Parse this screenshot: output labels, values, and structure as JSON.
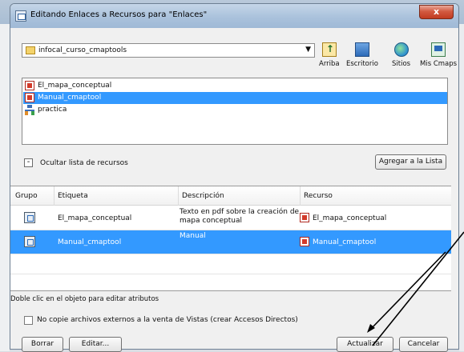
{
  "window": {
    "title": "Editando Enlaces a Recursos para \"Enlaces\"",
    "close_label": "x"
  },
  "folder_combo": {
    "value": "infocal_curso_cmaptools"
  },
  "nav": {
    "arriba": "Arriba",
    "escritorio": "Escritorio",
    "sitios": "Sitios",
    "mis_cmaps": "Mis Cmaps"
  },
  "resources": [
    {
      "label": "El_mapa_conceptual",
      "icon": "pdf-icon",
      "selected": false
    },
    {
      "label": "Manual_cmaptool",
      "icon": "pdf-icon",
      "selected": true
    },
    {
      "label": "practica",
      "icon": "network-icon",
      "selected": false
    }
  ],
  "toggle": {
    "symbol": "-",
    "label": "Ocultar lista de recursos"
  },
  "add_button": "Agregar a la Lista",
  "table": {
    "headers": [
      "Grupo",
      "Etiqueta",
      "Descripción",
      "Recurso"
    ],
    "rows": [
      {
        "label": "El_mapa_conceptual",
        "description": "Texto en pdf sobre la creación de mapa conceptual",
        "desc1": "Texto en pdf sobre la creación de",
        "desc2": "mapa conceptual",
        "resource": "El_mapa_conceptual",
        "selected": false
      },
      {
        "label": "Manual_cmaptool",
        "description": "Manual",
        "desc1": "Manual",
        "desc2": "",
        "resource": "Manual_cmaptool",
        "selected": true
      }
    ]
  },
  "hint": "Doble clic en el objeto para editar atributos",
  "checkbox": {
    "label": "No copie archivos externos a la venta de Vistas (crear Accesos Directos)",
    "checked": false
  },
  "buttons": {
    "borrar": "Borrar",
    "editar": "Editar...",
    "actualizar": "Actualizar",
    "cancelar": "Cancelar"
  },
  "colors": {
    "selection": "#3399ff",
    "close_button": "#c13b20"
  }
}
